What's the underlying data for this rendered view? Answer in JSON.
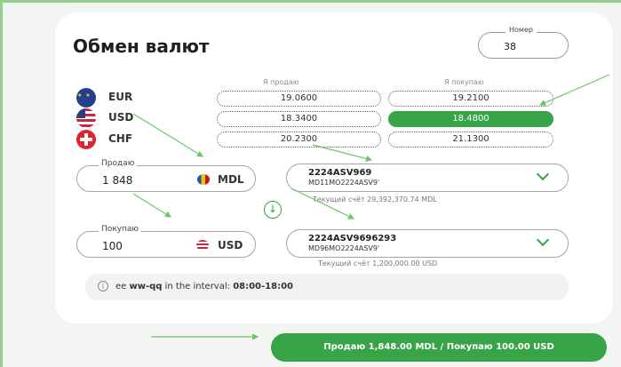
{
  "title": "Обмен валют",
  "nomer": {
    "label": "Номер",
    "value": "38"
  },
  "columns": {
    "sell": "Я продаю",
    "buy": "Я покупаю"
  },
  "currencies": [
    {
      "code": "EUR",
      "sell": "19.0600",
      "buy": "19.2100"
    },
    {
      "code": "USD",
      "sell": "18.3400",
      "buy": "18.4800"
    },
    {
      "code": "CHF",
      "sell": "20.2300",
      "buy": "21.1300"
    }
  ],
  "selected_rate": {
    "currency": "USD",
    "side": "buy"
  },
  "sell_field": {
    "label": "Продаю",
    "amount": "1 848",
    "currency": "MDL"
  },
  "sell_account": {
    "line1": "2224ASV969",
    "line2": "MD11MO2224ASV9'",
    "balance_label": "Текущий счёт",
    "balance": "29,392,370.74 MDL"
  },
  "buy_field": {
    "label": "Покупаю",
    "amount": "100",
    "currency": "USD"
  },
  "buy_account": {
    "line1": "2224ASV9696293",
    "line2": "MD96MO2224ASV9'",
    "balance_label": "Текущий счёт",
    "balance": "1,200,000.00 USD"
  },
  "info": {
    "prefix": "ee ",
    "bold": "ww-qq",
    "middle": " in the interval: ",
    "hours": "08:00-18:00"
  },
  "submit_label": "Продаю 1,848.00 MDL / Покупаю 100.00 USD",
  "colors": {
    "accent": "#36a447",
    "annotation_arrow": "#6cc56a"
  },
  "icons": {
    "swap": "arrow-down-circle-icon",
    "chevron": "chevron-down-icon",
    "info": "info-icon"
  }
}
